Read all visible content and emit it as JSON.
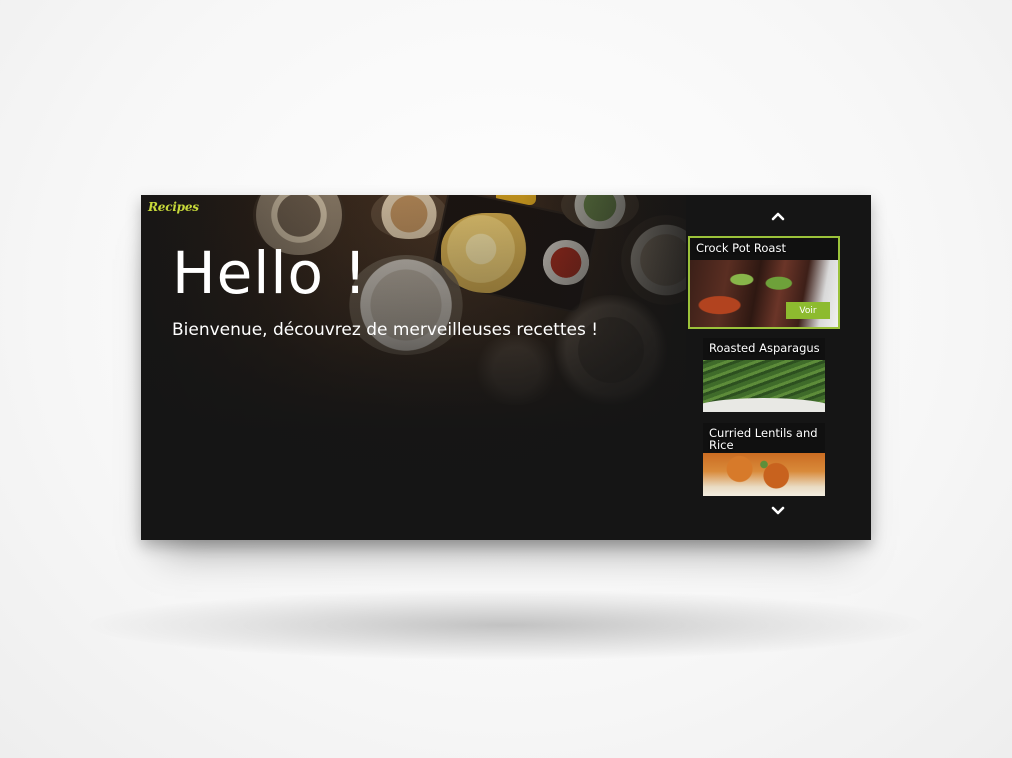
{
  "app": {
    "brand": "Recipes"
  },
  "hero": {
    "title": "Hello !",
    "subtitle": "Bienvenue, découvrez de merveilleuses recettes !"
  },
  "carousel": {
    "up_icon": "chevron-up-icon",
    "down_icon": "chevron-down-icon",
    "items": [
      {
        "title": "Crock Pot Roast",
        "action": "Voir",
        "active": true
      },
      {
        "title": "Roasted Asparagus",
        "active": false
      },
      {
        "title": "Curried Lentils and Rice",
        "active": false
      }
    ]
  },
  "colors": {
    "accent": "#9bc23a",
    "brand": "#c7d93a",
    "button": "#8dbb2f",
    "screen_bg": "#151515",
    "text": "#ffffff"
  }
}
